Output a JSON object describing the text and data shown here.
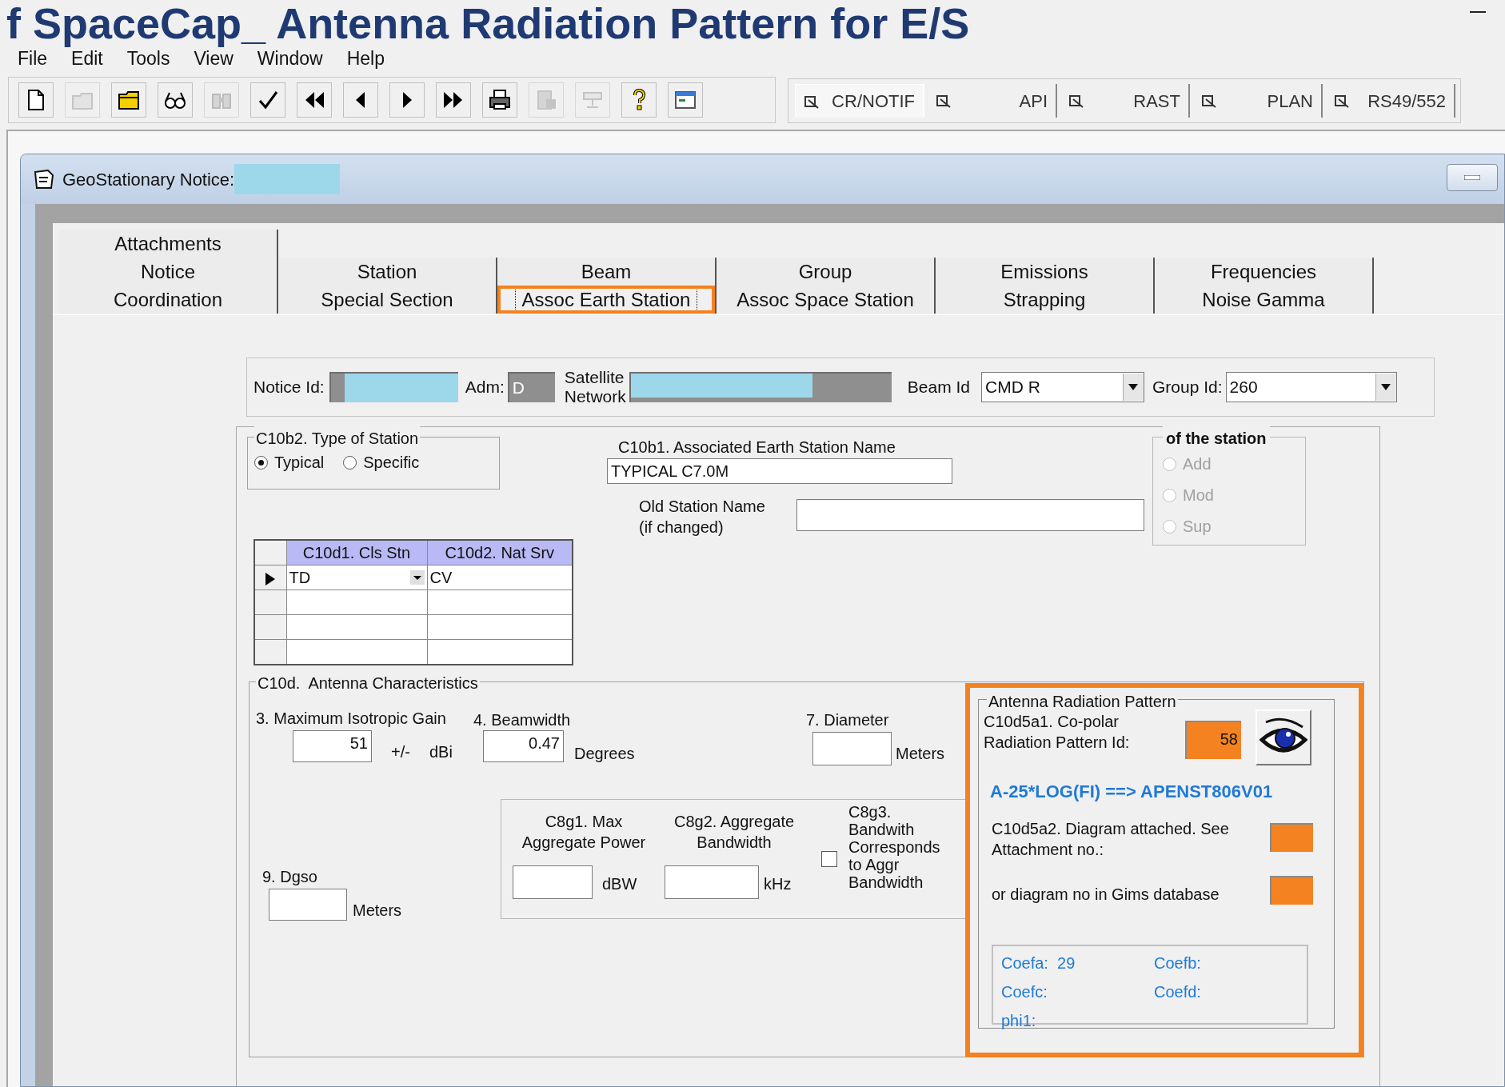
{
  "slide_title": "f SpaceCap_ Antenna Radiation Pattern for E/S",
  "menu": [
    "File",
    "Edit",
    "Tools",
    "View",
    "Window",
    "Help"
  ],
  "toolbar": [
    {
      "kind": "new",
      "disabled": false
    },
    {
      "kind": "open",
      "disabled": true
    },
    {
      "kind": "folder",
      "disabled": false
    },
    {
      "kind": "glasses",
      "disabled": false
    },
    {
      "kind": "binoculars",
      "disabled": true
    },
    {
      "kind": "check",
      "disabled": false
    },
    {
      "kind": "first",
      "disabled": false
    },
    {
      "kind": "prev",
      "disabled": false
    },
    {
      "kind": "next",
      "disabled": false
    },
    {
      "kind": "last",
      "disabled": false
    },
    {
      "kind": "print",
      "disabled": false
    },
    {
      "kind": "report",
      "disabled": true
    },
    {
      "kind": "form",
      "disabled": true
    },
    {
      "kind": "help",
      "disabled": false
    },
    {
      "kind": "window",
      "disabled": false
    }
  ],
  "modules": [
    "CR/NOTIF",
    "API",
    "RAST",
    "PLAN",
    "RS49/552"
  ],
  "child_window": {
    "title": "GeoStationary Notice:"
  },
  "tab_rows": [
    [
      {
        "label": "Attachments",
        "selected": false,
        "highlighted": false
      }
    ],
    [
      {
        "label": "Notice",
        "selected": false,
        "highlighted": false
      },
      {
        "label": "Station",
        "selected": false,
        "highlighted": false
      },
      {
        "label": "Beam",
        "selected": false,
        "highlighted": false
      },
      {
        "label": "Group",
        "selected": false,
        "highlighted": false
      },
      {
        "label": "Emissions",
        "selected": false,
        "highlighted": false
      },
      {
        "label": "Frequencies",
        "selected": false,
        "highlighted": false
      }
    ],
    [
      {
        "label": "Coordination",
        "selected": false,
        "highlighted": false
      },
      {
        "label": "Special Section",
        "selected": false,
        "highlighted": false
      },
      {
        "label": "Assoc Earth Station",
        "selected": true,
        "highlighted": true
      },
      {
        "label": "Assoc Space Station",
        "selected": false,
        "highlighted": false
      },
      {
        "label": "Strapping",
        "selected": false,
        "highlighted": false
      },
      {
        "label": "Noise Gamma",
        "selected": false,
        "highlighted": false
      }
    ]
  ],
  "header": {
    "notice_id": {
      "label": "Notice Id:"
    },
    "adm": {
      "label": "Adm:",
      "value": "D"
    },
    "satellite_network": {
      "label": "Satellite\nNetwork"
    },
    "beam_id": {
      "label": "Beam Id",
      "value": "CMD R"
    },
    "group_id": {
      "label": "Group Id:",
      "value": "260"
    }
  },
  "type_of_station": {
    "title": "C10b2. Type of Station",
    "options": [
      {
        "label": "Typical",
        "selected": true
      },
      {
        "label": "Specific",
        "selected": false
      }
    ]
  },
  "station_name": {
    "label": "C10b1. Associated Earth Station Name",
    "value": "TYPICAL C7.0M"
  },
  "old_station_name": {
    "label": "Old Station Name\n(if changed)"
  },
  "of_the_station": {
    "title": "of the station",
    "options": [
      {
        "label": "Add",
        "selected": false,
        "disabled": true
      },
      {
        "label": "Mod",
        "selected": false,
        "disabled": true
      },
      {
        "label": "Sup",
        "selected": false,
        "disabled": true
      }
    ]
  },
  "class_grid": {
    "columns": [
      "C10d1. Cls Stn",
      "C10d2. Nat Srv"
    ],
    "rows": [
      {
        "cells": [
          "TD",
          "CV"
        ],
        "current": true
      }
    ]
  },
  "antenna": {
    "title": "C10d.  Antenna Characteristics",
    "max_gain": {
      "label": "3. Maximum Isotropic Gain",
      "value": "51",
      "tolerance": "+/-",
      "unit": "dBi"
    },
    "beamwidth": {
      "label": "4. Beamwidth",
      "value": "0.47",
      "unit": "Degrees"
    },
    "diameter": {
      "label": "7. Diameter",
      "unit": "Meters"
    },
    "dgso": {
      "label": "9. Dgso",
      "unit": "Meters"
    },
    "power": {
      "label": "C8g1. Max\nAggregate Power",
      "unit": "dBW"
    },
    "bandwidth": {
      "label": "C8g2. Aggregate\nBandwidth",
      "unit": "kHz"
    },
    "corresponds": {
      "label": "C8g3.\nBandwith\nCorresponds\nto Aggr\nBandwidth",
      "checked": false
    }
  },
  "radiation_pattern": {
    "title": "Antenna Radiation Pattern",
    "highlighted": true,
    "copolar": {
      "label": "C10d5a1. Co-polar\nRadiation Pattern Id:",
      "value": "58"
    },
    "formula": "A-25*LOG(FI) ==> APENST806V01",
    "diagram_attached": {
      "label": "C10d5a2. Diagram attached.  See\nAttachment no.:"
    },
    "gims_diagram": {
      "label": "or diagram no in Gims database"
    },
    "coefficients": [
      {
        "label": "Coefa:",
        "value": "29"
      },
      {
        "label": "Coefb:"
      },
      {
        "label": "Coefc:"
      },
      {
        "label": "Coefd:"
      },
      {
        "label": "phi1:"
      }
    ]
  }
}
